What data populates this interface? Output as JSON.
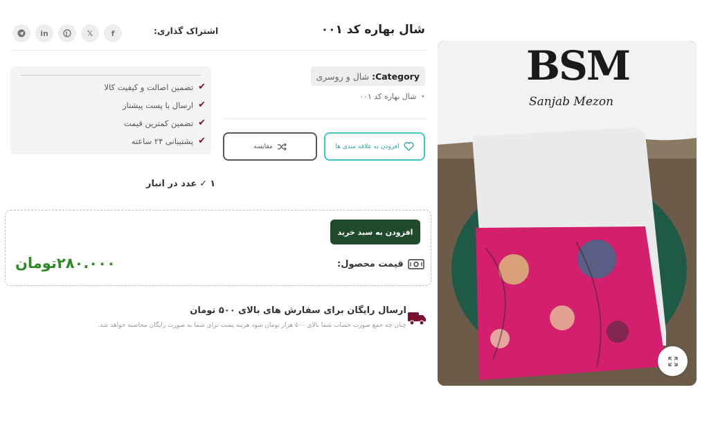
{
  "product": {
    "title": "شال بهاره کد ۰۰۱",
    "category_label": "Category:",
    "category_value": "شال و روسری",
    "bullet": "شال بهاره کد ۰۰۱"
  },
  "image": {
    "brand_logo": "BSM",
    "brand_tagline": "Sanjab Mezon"
  },
  "share": {
    "label": "اشتراک گذاری:",
    "icons": [
      "facebook-icon",
      "x-icon",
      "pinterest-icon",
      "linkedin-icon",
      "telegram-icon"
    ]
  },
  "actions": {
    "wishlist_label": "افزودن به علاقه مندی ها",
    "compare_label": "مقایسه",
    "add_to_cart_label": "افزودن به سبد خرید"
  },
  "guarantees": [
    "تضمین اصالت و کیفیت کالا",
    "ارسال با پست پیشتاز",
    "تضمین کمترین قیمت",
    "پشتیبانی ۲۴ ساعته"
  ],
  "stock": {
    "count": "۱",
    "text": "عدد در انبار"
  },
  "price": {
    "label": "قیمت محصول:",
    "value": "۲۸۰.۰۰۰تومان"
  },
  "shipping": {
    "title": "ارسال رایگان برای سفارش های بالای ۵۰۰ تومان",
    "description": "چنان چه جمع صورت حساب شما بالای ۵۰۰ هزار تومان شود هزینه پست برای شما به صورت رایگان محاصبه خواهد شد."
  },
  "colors": {
    "accent_teal": "#3fc7c4",
    "cart_button": "#1f4a2c",
    "price_green": "#2c8a22",
    "check_maroon": "#7a1030"
  }
}
